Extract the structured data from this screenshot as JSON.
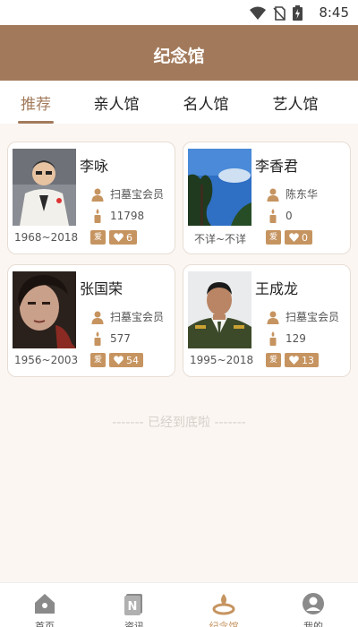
{
  "status_bar": {
    "time": "8:45"
  },
  "header": {
    "title": "纪念馆"
  },
  "tabs": [
    {
      "label": "推荐"
    },
    {
      "label": "亲人馆"
    },
    {
      "label": "名人馆"
    },
    {
      "label": "艺人馆"
    }
  ],
  "memorials": [
    {
      "name": "李咏",
      "creator": "扫墓宝会员",
      "candles": "11798",
      "dates": "1968~2018",
      "love_label": "爱",
      "likes": "6"
    },
    {
      "name": "李香君",
      "creator": "陈东华",
      "candles": "0",
      "dates": "不详~不详",
      "love_label": "爱",
      "likes": "0"
    },
    {
      "name": "张国荣",
      "creator": "扫墓宝会员",
      "candles": "577",
      "dates": "1956~2003",
      "love_label": "爱",
      "likes": "54"
    },
    {
      "name": "王成龙",
      "creator": "扫墓宝会员",
      "candles": "129",
      "dates": "1995~2018",
      "love_label": "爱",
      "likes": "13"
    }
  ],
  "end_text": "------- 已经到底啦 -------",
  "bottom_nav": [
    {
      "label": "首页",
      "icon": "home-icon"
    },
    {
      "label": "资讯",
      "icon": "news-icon"
    },
    {
      "label": "纪念馆",
      "icon": "memorial-icon"
    },
    {
      "label": "我的",
      "icon": "profile-icon"
    }
  ],
  "colors": {
    "brand": "#a27a5b",
    "accent": "#c69460",
    "background": "#fbf6f2"
  }
}
